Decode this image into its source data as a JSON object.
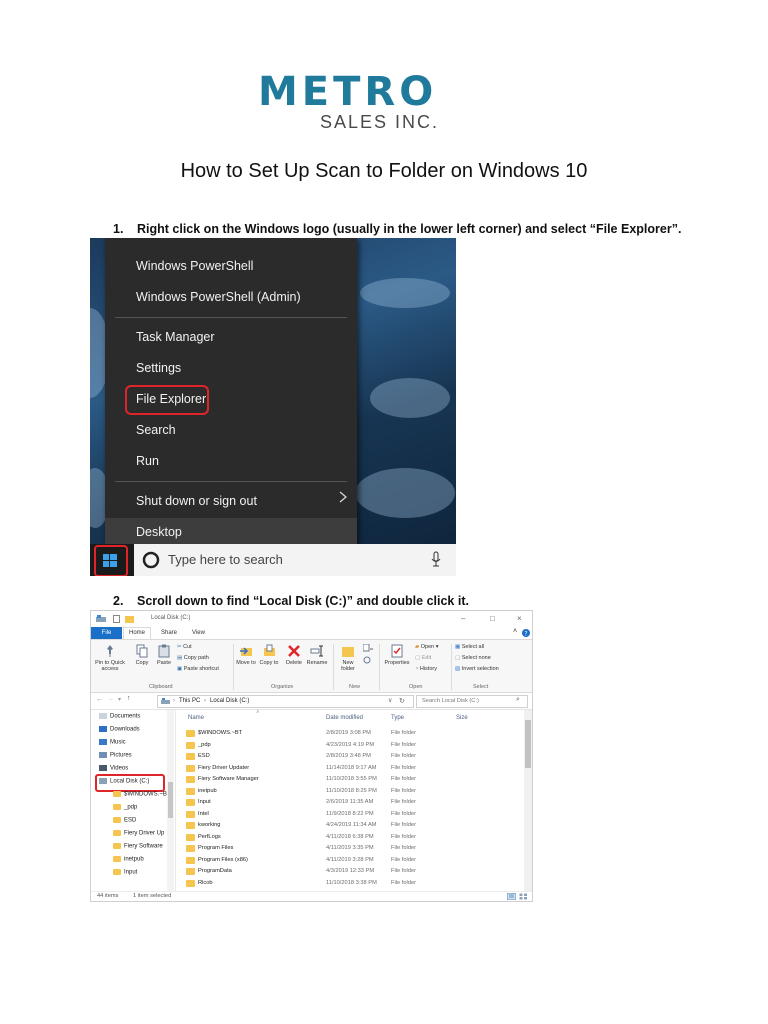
{
  "logo": {
    "main": "METRO",
    "sub": "SALES INC."
  },
  "title": "How to Set Up Scan to Folder on Windows 10",
  "steps": [
    {
      "number": "1.",
      "text": "Right click on the Windows logo (usually in the lower left corner) and select “File Explorer”."
    },
    {
      "number": "2.",
      "text": "Scroll down to find “Local Disk (C:)” and double click it."
    }
  ],
  "start_menu": {
    "items": [
      "Windows PowerShell",
      "Windows PowerShell (Admin)",
      "Task Manager",
      "Settings",
      "File Explorer",
      "Search",
      "Run",
      "Shut down or sign out",
      "Desktop"
    ],
    "highlighted": "File Explorer",
    "search_placeholder": "Type here to search",
    "highlight_color": "#e0252a"
  },
  "explorer": {
    "window_title": "Local Disk (C:)",
    "tabs": [
      "File",
      "Home",
      "Share",
      "View"
    ],
    "clipboard": {
      "pin": "Pin to Quick access",
      "copy": "Copy",
      "paste": "Paste",
      "cut": "Cut",
      "copy_path": "Copy path",
      "paste_shortcut": "Paste shortcut",
      "label": "Clipboard"
    },
    "organize": {
      "move": "Move to",
      "copy": "Copy to",
      "delete": "Delete",
      "rename": "Rename",
      "label": "Organize"
    },
    "new": {
      "folder": "New folder",
      "label": "New"
    },
    "open": {
      "properties": "Properties",
      "open": "Open",
      "edit": "Edit",
      "history": "History",
      "label": "Open"
    },
    "select": {
      "all": "Select all",
      "none": "Select none",
      "invert": "Invert selection",
      "label": "Select"
    },
    "breadcrumb": [
      "This PC",
      "Local Disk (C:)"
    ],
    "search_placeholder": "Search Local Disk (C:)",
    "nav": [
      "Documents",
      "Downloads",
      "Music",
      "Pictures",
      "Videos",
      "Local Disk (C:)",
      "$WINDOWS.~B",
      "_pdp",
      "ESD",
      "Fiery Driver Up",
      "Fiery Software",
      "inetpub",
      "Input"
    ],
    "columns": [
      "Name",
      "Date modified",
      "Type",
      "Size"
    ],
    "rows": [
      {
        "name": "$WINDOWS.~BT",
        "date": "2/8/2019 3:08 PM",
        "type": "File folder"
      },
      {
        "name": "_pdp",
        "date": "4/23/2019 4:19 PM",
        "type": "File folder"
      },
      {
        "name": "ESD",
        "date": "2/8/2019 3:48 PM",
        "type": "File folder"
      },
      {
        "name": "Fiery Driver Updater",
        "date": "11/14/2018 9:17 AM",
        "type": "File folder"
      },
      {
        "name": "Fiery Software Manager",
        "date": "11/10/2018 3:55 PM",
        "type": "File folder"
      },
      {
        "name": "inetpub",
        "date": "11/10/2018 8:25 PM",
        "type": "File folder"
      },
      {
        "name": "Input",
        "date": "2/6/2019 11:35 AM",
        "type": "File folder"
      },
      {
        "name": "Intel",
        "date": "11/9/2018 8:22 PM",
        "type": "File folder"
      },
      {
        "name": "kworking",
        "date": "4/24/2019 11:34 AM",
        "type": "File folder"
      },
      {
        "name": "PerfLogs",
        "date": "4/11/2018 6:38 PM",
        "type": "File folder"
      },
      {
        "name": "Program Files",
        "date": "4/11/2019 3:35 PM",
        "type": "File folder"
      },
      {
        "name": "Program Files (x86)",
        "date": "4/11/2019 3:28 PM",
        "type": "File folder"
      },
      {
        "name": "ProgramData",
        "date": "4/3/2019 12:33 PM",
        "type": "File folder"
      },
      {
        "name": "Rlcob",
        "date": "11/10/2018 3:38 PM",
        "type": "File folder"
      }
    ],
    "status": {
      "items": "44 items",
      "selected": "1 item selected"
    },
    "accent": "#1a6fc9"
  }
}
